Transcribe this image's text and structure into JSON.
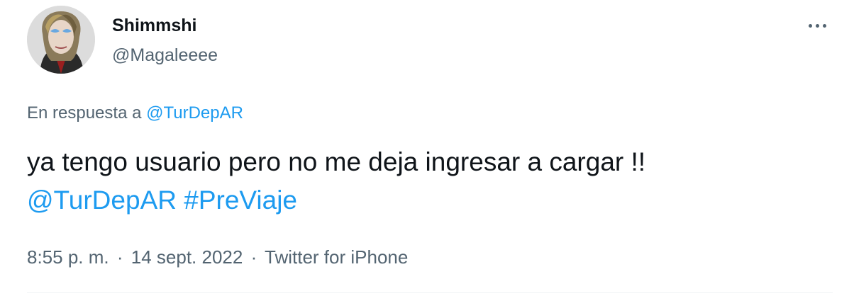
{
  "user": {
    "display_name": "Shimmshi",
    "handle": "@Magaleeee",
    "avatar_icon": "profile-photo"
  },
  "more_icon": "ellipsis-icon",
  "reply": {
    "prefix": "En respuesta a",
    "mention": "@TurDepAR"
  },
  "tweet": {
    "text_line1": "ya tengo usuario pero no me deja ingresar a cargar !!",
    "mention": "@TurDepAR",
    "hashtag": "#PreViaje"
  },
  "meta": {
    "time": "8:55 p. m.",
    "separator": "·",
    "date": "14 sept. 2022",
    "source": "Twitter for iPhone"
  },
  "colors": {
    "text": "#0f1419",
    "secondary": "#536471",
    "link": "#1d9bf0"
  }
}
